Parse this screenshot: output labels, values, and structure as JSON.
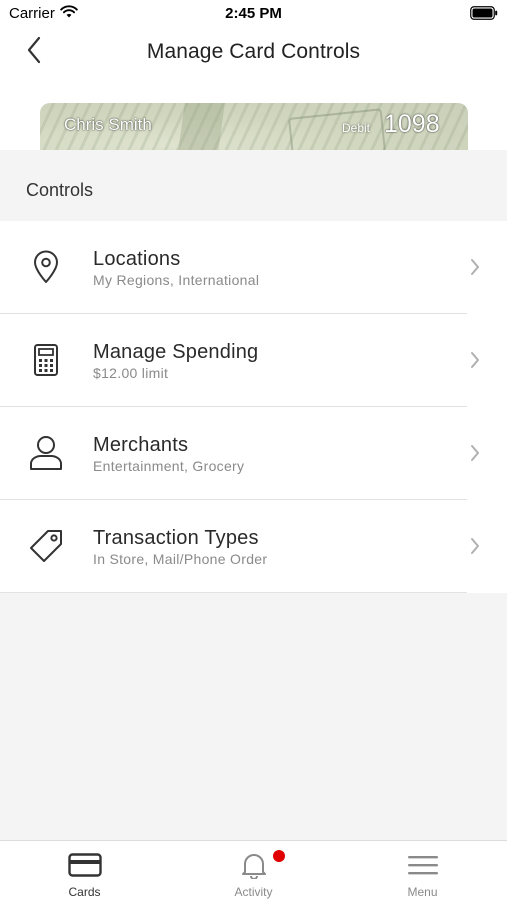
{
  "status_bar": {
    "carrier": "Carrier",
    "time": "2:45 PM"
  },
  "nav": {
    "title": "Manage Card Controls",
    "back_icon": "chevron-left-icon"
  },
  "card": {
    "holder_name": "Chris Smith",
    "type": "Debit",
    "last4": "1098"
  },
  "section": {
    "title": "Controls"
  },
  "controls": [
    {
      "title": "Locations",
      "subtitle": "My Regions, International",
      "icon": "location-pin-icon"
    },
    {
      "title": "Manage Spending",
      "subtitle": "$12.00 limit",
      "icon": "calculator-icon"
    },
    {
      "title": "Merchants",
      "subtitle": "Entertainment, Grocery",
      "icon": "person-icon"
    },
    {
      "title": "Transaction Types",
      "subtitle": "In Store, Mail/Phone Order",
      "icon": "tag-icon"
    }
  ],
  "tabs": [
    {
      "label": "Cards",
      "icon": "card-icon",
      "active": true
    },
    {
      "label": "Activity",
      "icon": "bell-icon",
      "active": false,
      "badge": true
    },
    {
      "label": "Menu",
      "icon": "hamburger-icon",
      "active": false
    }
  ],
  "colors": {
    "accent_badge": "#e00000",
    "background": "#f4f4f4",
    "surface": "#ffffff"
  }
}
